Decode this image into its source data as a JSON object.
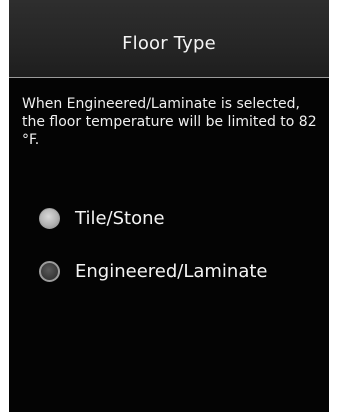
{
  "header": {
    "title": "Floor Type"
  },
  "message": {
    "text": "When Engineered/Laminate is selected, the floor temperature will be limited to 82 °F."
  },
  "floor_type_options": [
    {
      "label": "Tile/Stone",
      "icon": "radio-selected-icon",
      "selected": true
    },
    {
      "label": "Engineered/Laminate",
      "icon": "radio-unselected-icon",
      "selected": false
    }
  ],
  "colors": {
    "background": "#040404",
    "header_background": "#2a2a2a",
    "header_divider": "#9a9a9a",
    "text": "#f2f2f2"
  }
}
